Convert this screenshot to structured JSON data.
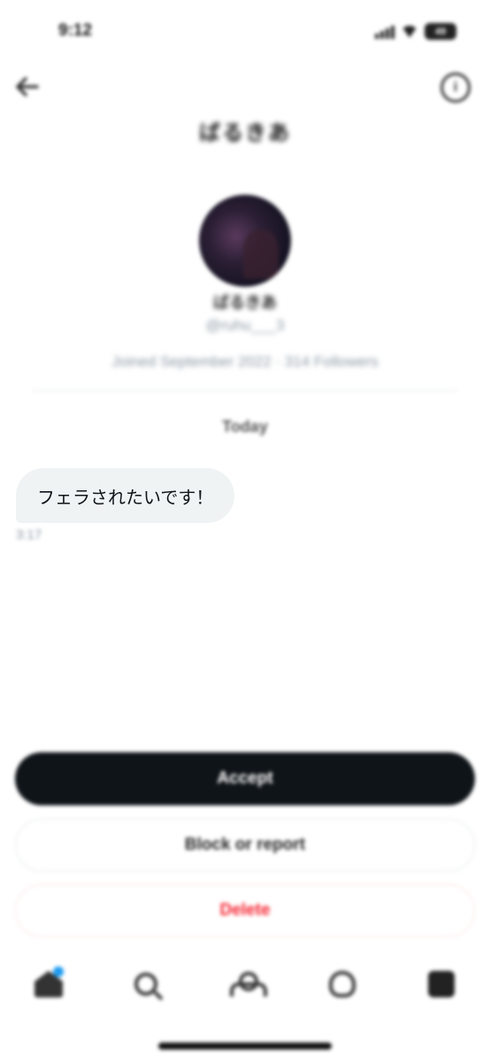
{
  "status_bar": {
    "time": "9:12",
    "battery": "49"
  },
  "header": {
    "title": "ばるきあ",
    "back_icon": "arrow-left-icon",
    "info_icon": "info-icon"
  },
  "profile": {
    "name": "ばるきあ",
    "handle": "@ruhu___3",
    "meta": "Joined September 2022 · 314 Followers"
  },
  "conversation": {
    "date_label": "Today",
    "messages": [
      {
        "text": "フェラされたいです！",
        "time": "3:17"
      }
    ]
  },
  "actions": {
    "accept_label": "Accept",
    "block_label": "Block or report",
    "delete_label": "Delete"
  },
  "tab_bar": {
    "items": [
      "home-icon",
      "search-icon",
      "communities-icon",
      "notifications-icon",
      "messages-icon"
    ]
  },
  "colors": {
    "accept_bg": "#0f1419",
    "delete_text": "#f4212e",
    "bubble_bg": "#eff3f4",
    "notification_dot": "#1d9bf0"
  }
}
